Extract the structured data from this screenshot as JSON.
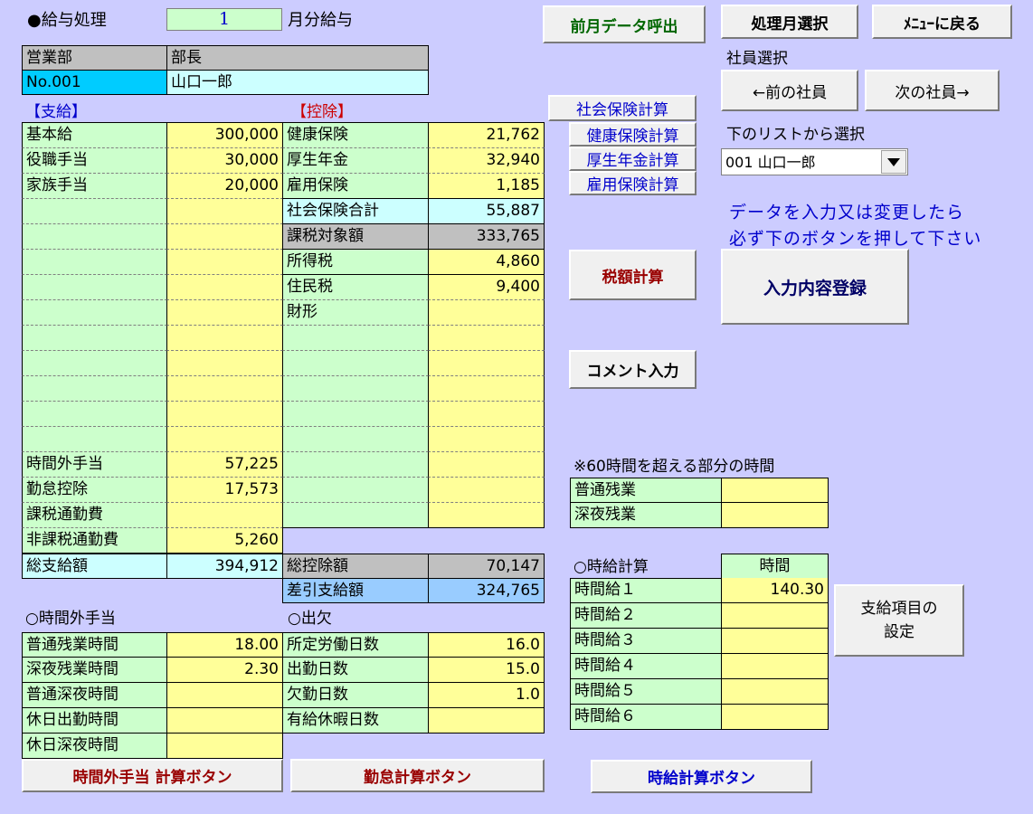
{
  "header": {
    "title": "●給与処理",
    "month_value": "1",
    "month_suffix": "月分給与",
    "dept": "営業部",
    "position": "部長",
    "emp_no": "No.001",
    "emp_name": "山口一郎"
  },
  "buttons": {
    "prev_month_data": "前月データ呼出",
    "select_month": "処理月選択",
    "back_menu": "ﾒﾆｭｰに戻る",
    "prev_emp": "←前の社員",
    "next_emp": "次の社員→",
    "social_ins_calc": "社会保険計算",
    "health_calc": "健康保険計算",
    "pension_calc": "厚生年金計算",
    "employ_calc": "雇用保険計算",
    "tax_calc": "税額計算",
    "register": "入力内容登録",
    "comment": "コメント入力",
    "pay_item_setting_1": "支給項目の",
    "pay_item_setting_2": "設定",
    "overtime_calc": "時間外手当 計算ボタン",
    "attendance_calc": "勤怠計算ボタン",
    "hourly_calc": "時給計算ボタン"
  },
  "side": {
    "emp_select_label": "社員選択",
    "list_select_label": "下のリストから選択",
    "dropdown_value": "001 山口一郎",
    "notice_1": "データを入力又は変更したら",
    "notice_2": "必ず下のボタンを押して下さい",
    "over60_title": "※60時間を超える部分の時間",
    "over60_rows": [
      "普通残業",
      "深夜残業"
    ],
    "hourly_title": "○時給計算",
    "hourly_col": "時間",
    "hourly_rows": [
      {
        "label": "時間給１",
        "value": "140.30"
      },
      {
        "label": "時間給２",
        "value": ""
      },
      {
        "label": "時間給３",
        "value": ""
      },
      {
        "label": "時間給４",
        "value": ""
      },
      {
        "label": "時間給５",
        "value": ""
      },
      {
        "label": "時間給６",
        "value": ""
      }
    ]
  },
  "pay": {
    "title": "【支給】",
    "rows": [
      {
        "label": "基本給",
        "value": "300,000"
      },
      {
        "label": "役職手当",
        "value": "30,000"
      },
      {
        "label": "家族手当",
        "value": "20,000"
      },
      {
        "label": "",
        "value": ""
      },
      {
        "label": "",
        "value": ""
      },
      {
        "label": "",
        "value": ""
      },
      {
        "label": "",
        "value": ""
      },
      {
        "label": "",
        "value": ""
      },
      {
        "label": "",
        "value": ""
      },
      {
        "label": "",
        "value": ""
      },
      {
        "label": "",
        "value": ""
      },
      {
        "label": "",
        "value": ""
      },
      {
        "label": "",
        "value": ""
      },
      {
        "label": "時間外手当",
        "value": "57,225"
      },
      {
        "label": "勤怠控除",
        "value": "17,573"
      },
      {
        "label": "課税通勤費",
        "value": ""
      },
      {
        "label": "非課税通勤費",
        "value": "5,260"
      }
    ],
    "total_label": "総支給額",
    "total_value": "394,912"
  },
  "deduction": {
    "title": "【控除】",
    "rows": [
      {
        "label": "健康保険",
        "value": "21,762"
      },
      {
        "label": "厚生年金",
        "value": "32,940"
      },
      {
        "label": "雇用保険",
        "value": "1,185"
      }
    ],
    "social_total_label": "社会保険合計",
    "social_total_value": "55,887",
    "taxable_label": "課税対象額",
    "taxable_value": "333,765",
    "rows2": [
      {
        "label": "所得税",
        "value": "4,860"
      },
      {
        "label": "住民税",
        "value": "9,400"
      },
      {
        "label": "財形",
        "value": ""
      },
      {
        "label": "",
        "value": ""
      },
      {
        "label": "",
        "value": ""
      },
      {
        "label": "",
        "value": ""
      },
      {
        "label": "",
        "value": ""
      },
      {
        "label": "",
        "value": ""
      },
      {
        "label": "",
        "value": ""
      },
      {
        "label": "",
        "value": ""
      },
      {
        "label": "",
        "value": ""
      }
    ],
    "total_label": "総控除額",
    "total_value": "70,147",
    "net_label": "差引支給額",
    "net_value": "324,765"
  },
  "overtime": {
    "title": "○時間外手当",
    "rows": [
      {
        "label": "普通残業時間",
        "value": "18.00"
      },
      {
        "label": "深夜残業時間",
        "value": "2.30"
      },
      {
        "label": "普通深夜時間",
        "value": ""
      },
      {
        "label": "休日出勤時間",
        "value": ""
      },
      {
        "label": "休日深夜時間",
        "value": ""
      }
    ]
  },
  "attendance": {
    "title": "○出欠",
    "rows": [
      {
        "label": "所定労働日数",
        "value": "16.0"
      },
      {
        "label": "出勤日数",
        "value": "15.0"
      },
      {
        "label": "欠勤日数",
        "value": "1.0"
      },
      {
        "label": "有給休暇日数",
        "value": ""
      }
    ]
  },
  "colors": {
    "background": "#ccccff",
    "label_green": "#ccffcc",
    "value_yellow": "#ffff99",
    "emp_no_blue": "#00ccff",
    "net_blue": "#99ccff",
    "accent_red": "#990000",
    "notice_blue": "#0000cc"
  }
}
